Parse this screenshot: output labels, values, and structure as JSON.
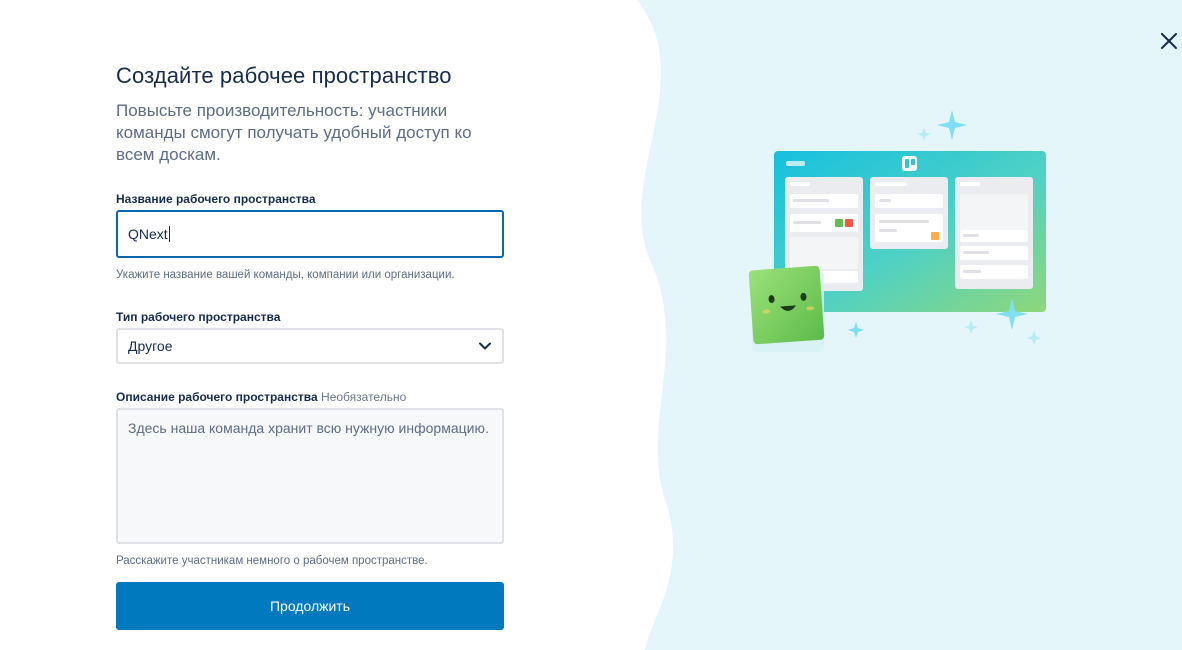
{
  "dialog": {
    "title": "Создайте рабочее пространство",
    "subtitle": "Повысьте производительность: участники команды смогут получать удобный доступ ко всем доскам.",
    "close_icon": "close-icon"
  },
  "workspace_name": {
    "label": "Название рабочего пространства",
    "value": "QNext",
    "hint": "Укажите название вашей команды, компании или организации."
  },
  "workspace_type": {
    "label": "Тип рабочего пространства",
    "selected": "Другое",
    "icon": "chevron-down-icon"
  },
  "workspace_description": {
    "label": "Описание рабочего пространства",
    "optional": "Необязательно",
    "placeholder": "Здесь наша команда хранит всю нужную информацию.",
    "hint": "Расскажите участникам немного о рабочем пространстве."
  },
  "actions": {
    "continue_label": "Продолжить"
  },
  "colors": {
    "accent": "#0079bf",
    "input_focus": "#0c66ad",
    "background_wave": "#e4f6fa",
    "title": "#172b4d",
    "secondary_text": "#5e6c84"
  }
}
